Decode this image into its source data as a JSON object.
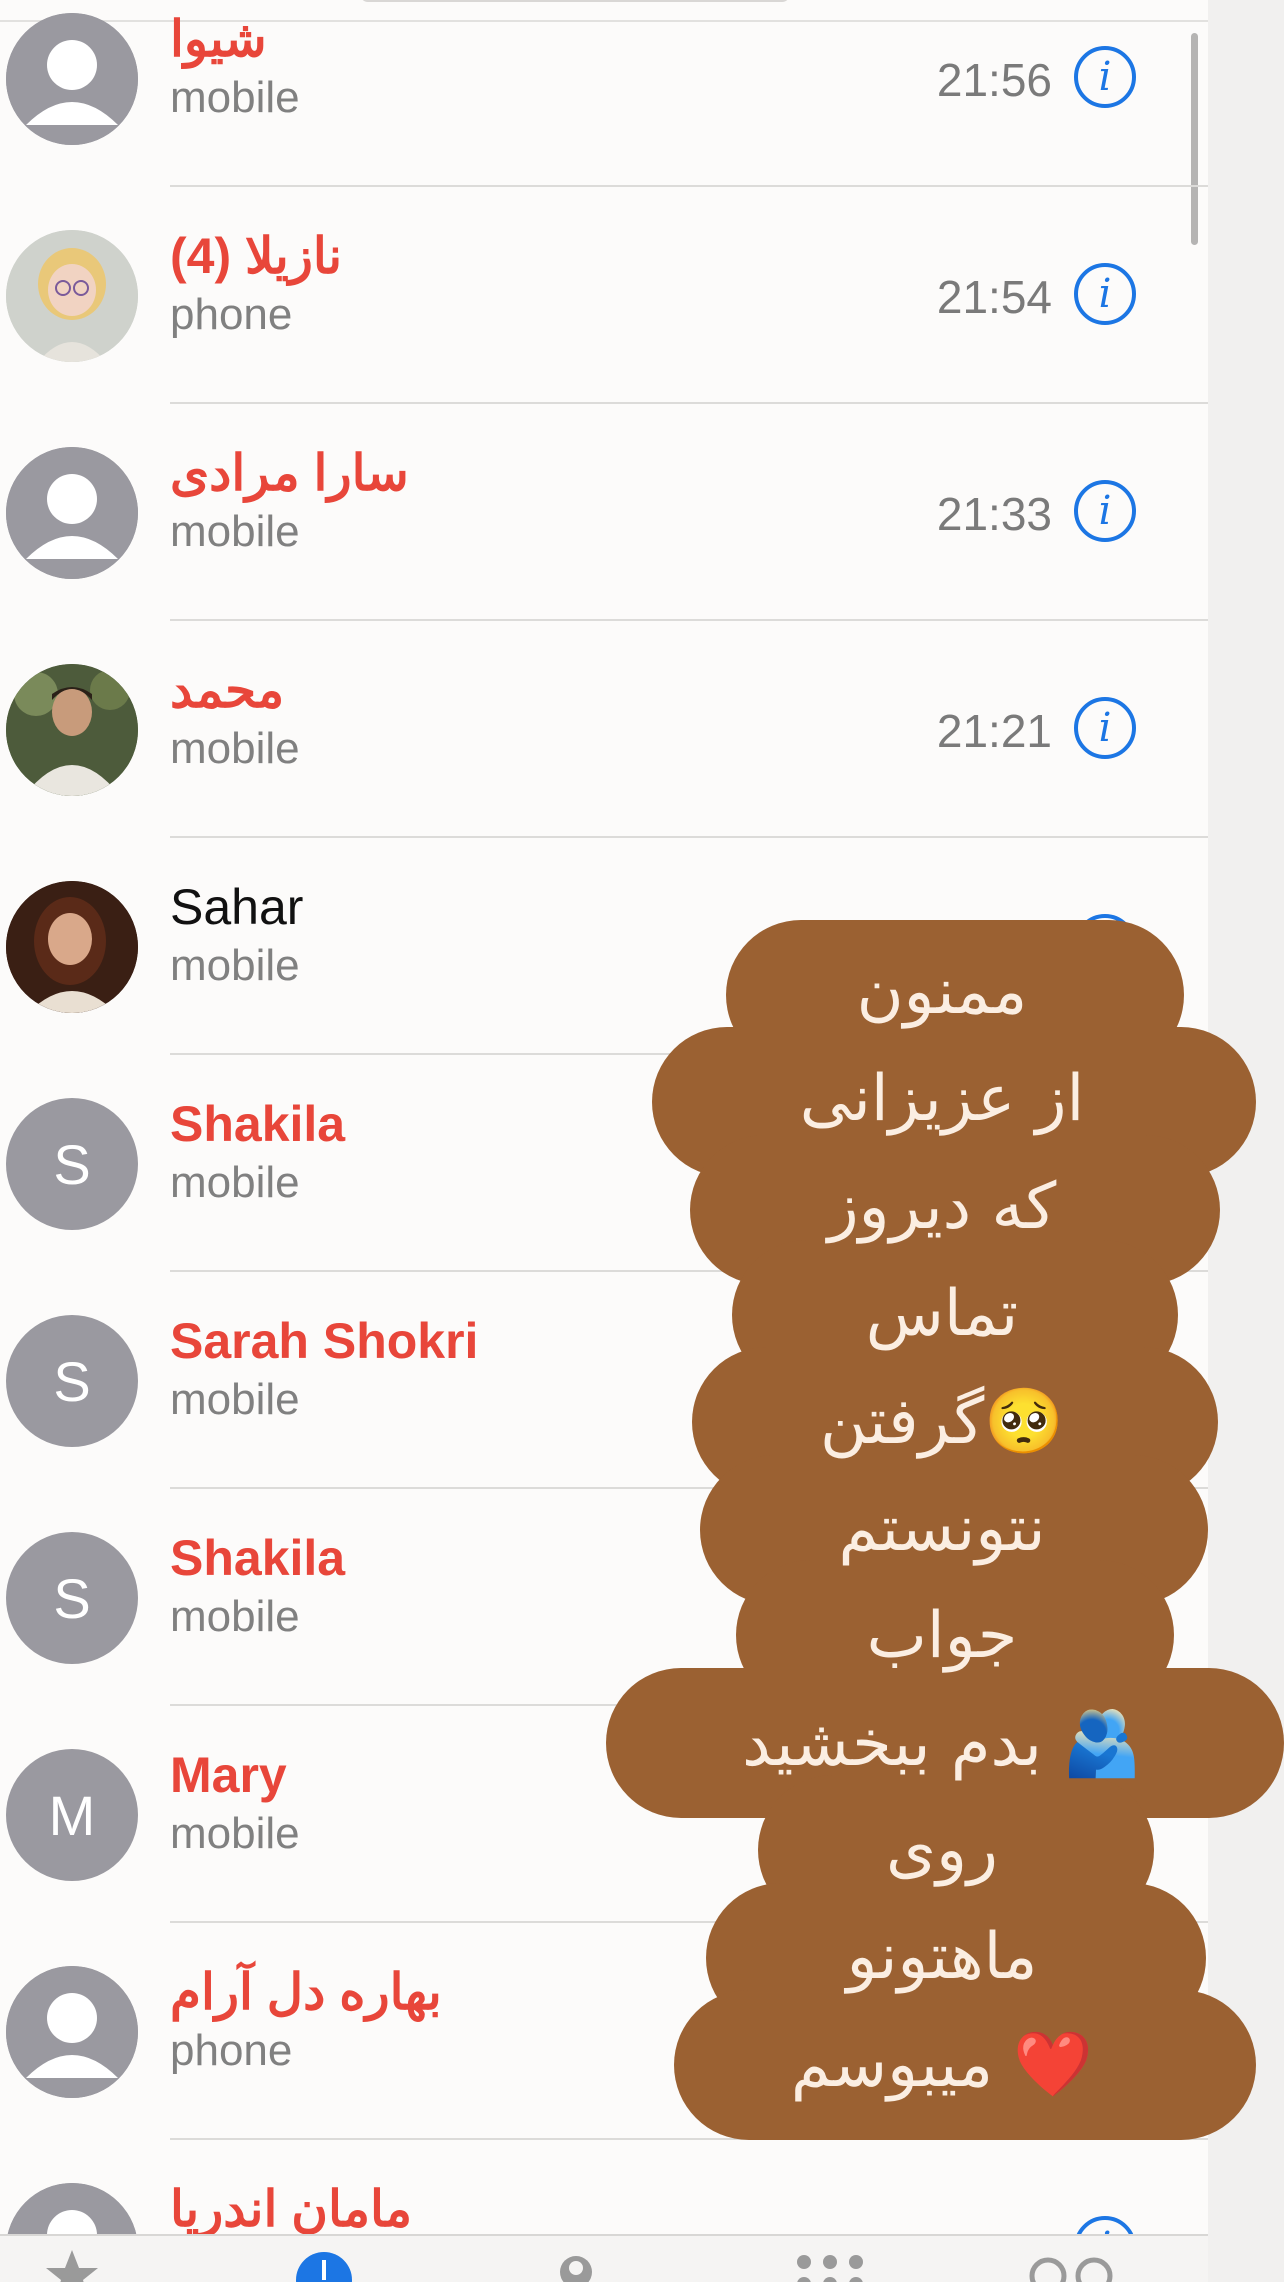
{
  "contacts": [
    {
      "name": "شیوا",
      "type": "mobile",
      "time": "21:56",
      "avatar": "generic",
      "missed": true
    },
    {
      "name": "نازیلا (4)",
      "type": "phone",
      "time": "21:54",
      "avatar": "memoji-blonde",
      "missed": true
    },
    {
      "name": "سارا  مرادی",
      "type": "mobile",
      "time": "21:33",
      "avatar": "generic",
      "missed": true
    },
    {
      "name": "محمد",
      "type": "mobile",
      "time": "21:21",
      "avatar": "photo-man",
      "missed": true
    },
    {
      "name": "Sahar",
      "type": "mobile",
      "time": "",
      "avatar": "photo-woman",
      "missed": false
    },
    {
      "name": "Shakila",
      "type": "mobile",
      "time": "",
      "avatar": "initial",
      "initial": "S",
      "missed": true
    },
    {
      "name": "Sarah Shokri",
      "type": "mobile",
      "time": "",
      "avatar": "initial",
      "initial": "S",
      "missed": true
    },
    {
      "name": "Shakila",
      "type": "mobile",
      "time": "",
      "avatar": "initial",
      "initial": "S",
      "missed": true
    },
    {
      "name": "Mary",
      "type": "mobile",
      "time": "",
      "avatar": "initial",
      "initial": "M",
      "missed": true
    },
    {
      "name": "بهاره دل آرام",
      "type": "phone",
      "time": "",
      "avatar": "generic",
      "missed": true
    },
    {
      "name": "مامان اندریا",
      "type": "",
      "time": "",
      "avatar": "generic",
      "missed": true
    }
  ],
  "info_icon": "info-circle-icon",
  "colors": {
    "missed": "#e8463a",
    "accent": "#1c76e4",
    "sticker": "#9b6132"
  },
  "sticker": {
    "lines": [
      "ممنون",
      "از عزیزانی",
      "که دیروز",
      "تماس",
      "گرفتن🥺",
      "نتونستم",
      "جواب",
      "بدم ببخشید 🫂",
      "روی",
      "ماهتونو",
      "میبوسم ❤️"
    ]
  },
  "tabbar": {
    "icons": [
      "favorites-star-icon",
      "recents-clock-icon",
      "contacts-person-icon",
      "keypad-icon",
      "voicemail-icon"
    ]
  }
}
